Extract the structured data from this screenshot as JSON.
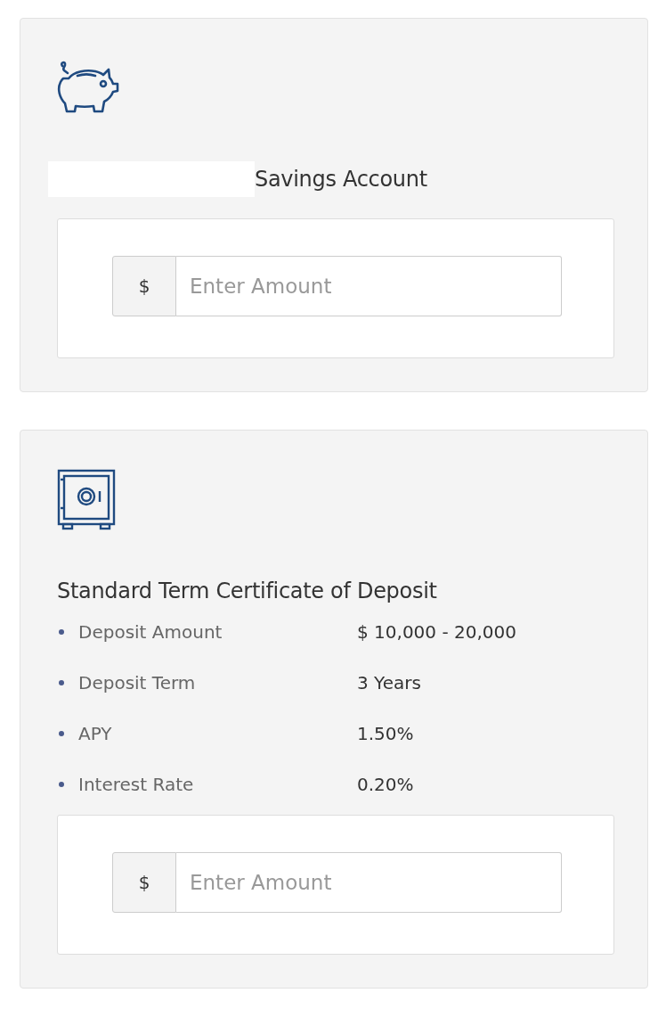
{
  "accounts": [
    {
      "kind": "savings",
      "redacted_prefix": true,
      "title": "Savings Account",
      "amount": {
        "currency": "$",
        "placeholder": "Enter Amount"
      }
    },
    {
      "kind": "certificate",
      "redacted_prefix": false,
      "title": "Standard Term Certificate of Deposit",
      "details": [
        {
          "label": "Deposit Amount",
          "value": "$ 10,000 - 20,000"
        },
        {
          "label": "Deposit Term",
          "value": "3 Years"
        },
        {
          "label": "APY",
          "value": "1.50%"
        },
        {
          "label": "Interest Rate",
          "value": "0.20%"
        }
      ],
      "amount": {
        "currency": "$",
        "placeholder": "Enter Amount"
      }
    }
  ]
}
